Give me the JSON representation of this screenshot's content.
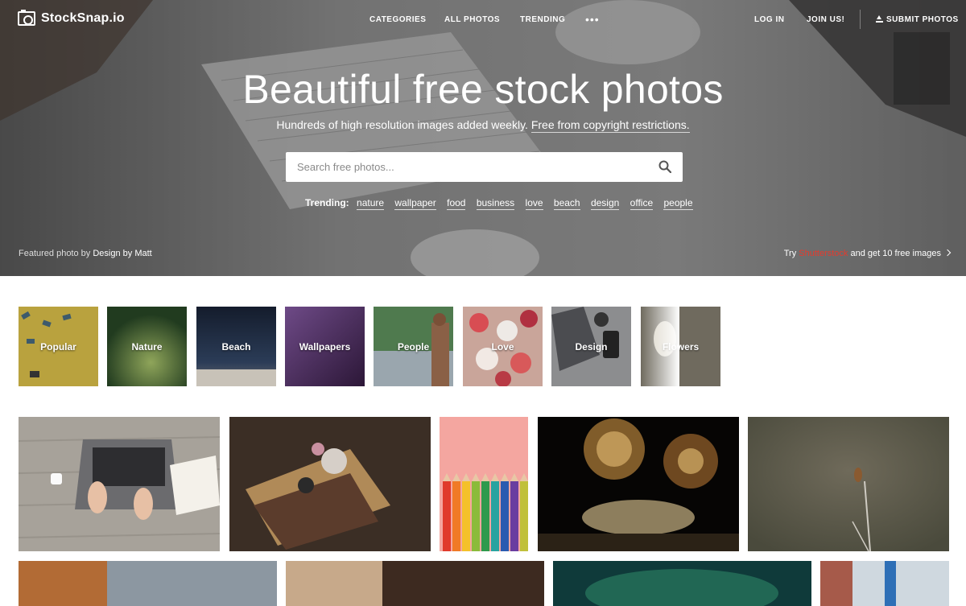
{
  "brand": {
    "logo_text": "StockSnap.io",
    "accent": "#e33b2e"
  },
  "nav": {
    "categories": "CATEGORIES",
    "all_photos": "ALL PHOTOS",
    "trending": "TRENDING",
    "more": "•••",
    "log_in": "LOG IN",
    "join": "JOIN US!",
    "submit": "SUBMIT PHOTOS"
  },
  "hero": {
    "headline": "Beautiful free stock photos",
    "subhead_text": "Hundreds of high resolution images added weekly.",
    "subhead_link": "Free from copyright restrictions.",
    "search_placeholder": "Search free photos...",
    "trending_label": "Trending:",
    "trending_tags": [
      "nature",
      "wallpaper",
      "food",
      "business",
      "love",
      "beach",
      "design",
      "office",
      "people"
    ],
    "credit_prefix": "Featured photo by",
    "credit_author": "Design by Matt",
    "promo_prefix": "Try",
    "promo_brand": "Shutterstock",
    "promo_suffix": "and get 10 free images"
  },
  "categories": [
    {
      "label": "Popular"
    },
    {
      "label": "Nature"
    },
    {
      "label": "Beach"
    },
    {
      "label": "Wallpapers"
    },
    {
      "label": "People"
    },
    {
      "label": "Love"
    },
    {
      "label": "Design"
    },
    {
      "label": "Flowers"
    }
  ]
}
